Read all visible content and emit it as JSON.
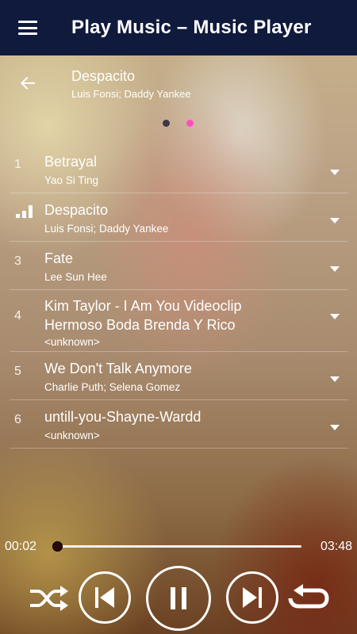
{
  "appbar": {
    "title": "Play Music – Music Player",
    "menu_icon": "hamburger-menu-icon"
  },
  "now_playing": {
    "title": "Despacito",
    "artist": "Luis Fonsi; Daddy Yankee",
    "back_icon": "arrow-left-icon"
  },
  "pager": {
    "pages": 2,
    "active_page": 2,
    "active_color": "#ff4fbf"
  },
  "songs": [
    {
      "number": "1",
      "title": "Betrayal",
      "artist": "Yao Si Ting",
      "playing": false
    },
    {
      "number": "",
      "title": "Despacito",
      "artist": "Luis Fonsi; Daddy Yankee",
      "playing": true
    },
    {
      "number": "3",
      "title": "Fate",
      "artist": "Lee Sun Hee",
      "playing": false
    },
    {
      "number": "4",
      "title_line1": "Kim Taylor - I Am You Videoclip",
      "title_line2": "Hermoso Boda Brenda Y Rico",
      "artist": "<unknown>",
      "playing": false
    },
    {
      "number": "5",
      "title": "We Don't Talk Anymore",
      "artist": "Charlie Puth; Selena Gomez",
      "playing": false
    },
    {
      "number": "6",
      "title": "untill-you-Shayne-Wardd",
      "artist": "<unknown>",
      "playing": false
    }
  ],
  "player": {
    "current_time": "00:02",
    "total_time": "03:48",
    "progress": 0.01,
    "controls": [
      "shuffle-icon",
      "previous-icon",
      "pause-icon",
      "next-icon",
      "repeat-icon"
    ]
  },
  "colors": {
    "appbar": "#101a3c",
    "accent": "#ff4fbf"
  }
}
